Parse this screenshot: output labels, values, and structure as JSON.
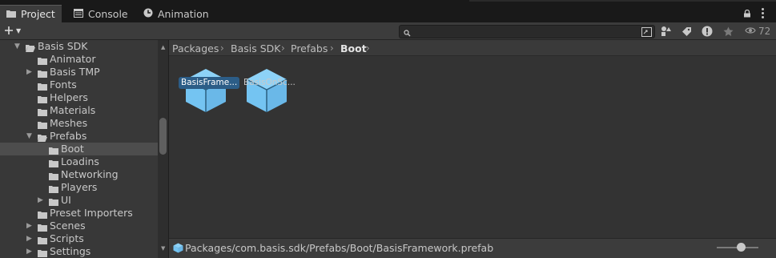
{
  "tabs": [
    {
      "label": "Project",
      "icon": "folder-icon",
      "active": true
    },
    {
      "label": "Console",
      "icon": "console-icon",
      "active": false
    },
    {
      "label": "Animation",
      "icon": "animation-icon",
      "active": false
    }
  ],
  "toolbar": {
    "add_icon": "plus-icon",
    "search": {
      "placeholder": "",
      "value": ""
    },
    "hidden_count": "72"
  },
  "tree": [
    {
      "label": "Basis SDK",
      "depth": 0,
      "expanded": true,
      "arrow": "down",
      "selected": false,
      "open": true
    },
    {
      "label": "Animator",
      "depth": 1,
      "arrow": "",
      "selected": false
    },
    {
      "label": "Basis TMP",
      "depth": 1,
      "arrow": "right",
      "selected": false
    },
    {
      "label": "Fonts",
      "depth": 1,
      "arrow": "",
      "selected": false
    },
    {
      "label": "Helpers",
      "depth": 1,
      "arrow": "",
      "selected": false
    },
    {
      "label": "Materials",
      "depth": 1,
      "arrow": "",
      "selected": false
    },
    {
      "label": "Meshes",
      "depth": 1,
      "arrow": "",
      "selected": false
    },
    {
      "label": "Prefabs",
      "depth": 1,
      "arrow": "down",
      "selected": false,
      "open": true
    },
    {
      "label": "Boot",
      "depth": 2,
      "arrow": "",
      "selected": true
    },
    {
      "label": "Loadins",
      "depth": 2,
      "arrow": "",
      "selected": false
    },
    {
      "label": "Networking",
      "depth": 2,
      "arrow": "",
      "selected": false
    },
    {
      "label": "Players",
      "depth": 2,
      "arrow": "",
      "selected": false
    },
    {
      "label": "UI",
      "depth": 2,
      "arrow": "right",
      "selected": false
    },
    {
      "label": "Preset Importers",
      "depth": 1,
      "arrow": "",
      "selected": false
    },
    {
      "label": "Scenes",
      "depth": 1,
      "arrow": "right",
      "selected": false
    },
    {
      "label": "Scripts",
      "depth": 1,
      "arrow": "right",
      "selected": false
    },
    {
      "label": "Settings",
      "depth": 1,
      "arrow": "right",
      "selected": false
    }
  ],
  "breadcrumb": [
    "Packages",
    "Basis SDK",
    "Prefabs",
    "Boot"
  ],
  "assets": [
    {
      "label": "BasisFrame...",
      "selected": true
    },
    {
      "label": "BasisOnSc...",
      "selected": false
    }
  ],
  "status": {
    "path": "Packages/com.basis.sdk/Prefabs/Boot/BasisFramework.prefab"
  },
  "colors": {
    "accent": "#2c5d87",
    "cube": "#74c4f2"
  }
}
